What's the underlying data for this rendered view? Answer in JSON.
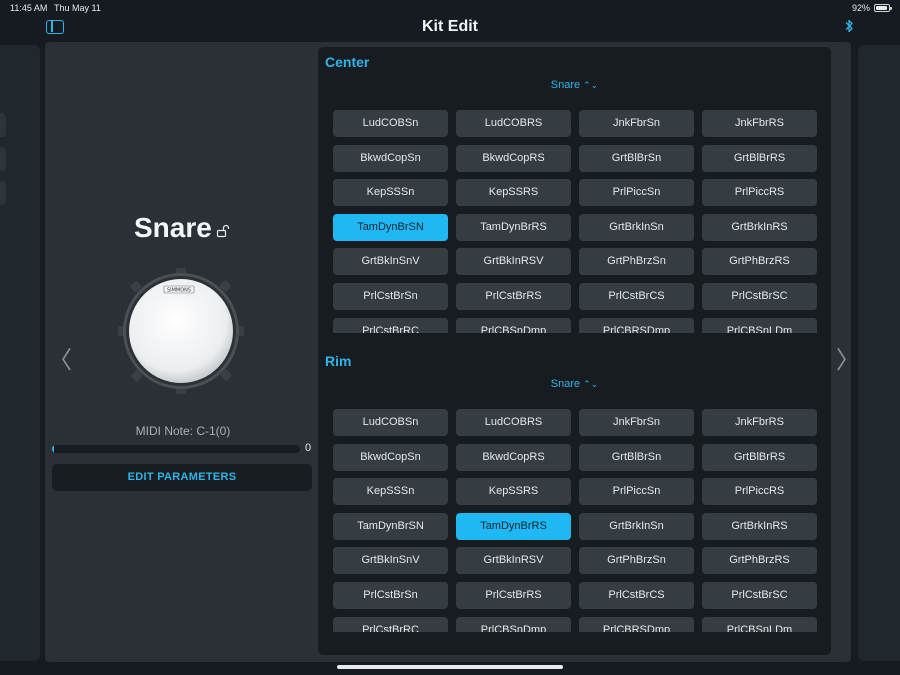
{
  "status": {
    "time": "11:45 AM",
    "date": "Thu May 11",
    "battery": "92%"
  },
  "nav": {
    "title": "Kit Edit"
  },
  "pad": {
    "name": "Snare",
    "midi_note": "MIDI Note: C-1(0)",
    "velocity_value": "0",
    "velocity_fraction": 0,
    "edit_button": "EDIT PARAMETERS",
    "drum_brand": "SIMMONS"
  },
  "chevrons": {
    "left": "〈",
    "right": "〉"
  },
  "sections": [
    {
      "title": "Center",
      "group": "Snare",
      "selected_index": 12,
      "items": [
        "LudCOBSn",
        "LudCOBRS",
        "JnkFbrSn",
        "JnkFbrRS",
        "BkwdCopSn",
        "BkwdCopRS",
        "GrtBlBrSn",
        "GrtBlBrRS",
        "KepSSSn",
        "KepSSRS",
        "PrlPiccSn",
        "PrlPiccRS",
        "TamDynBrSN",
        "TamDynBrRS",
        "GrtBrkInSn",
        "GrtBrkInRS",
        "GrtBkInSnV",
        "GrtBkInRSV",
        "GrtPhBrzSn",
        "GrtPhBrzRS",
        "PrlCstBrSn",
        "PrlCstBrRS",
        "PrlCstBrCS",
        "PrlCstBrSC",
        "PrlCstBrRC",
        "PrlCBSnDmp",
        "PrlCBRSDmp",
        "PrlCBSnLDm"
      ]
    },
    {
      "title": "Rim",
      "group": "Snare",
      "selected_index": 13,
      "items": [
        "LudCOBSn",
        "LudCOBRS",
        "JnkFbrSn",
        "JnkFbrRS",
        "BkwdCopSn",
        "BkwdCopRS",
        "GrtBlBrSn",
        "GrtBlBrRS",
        "KepSSSn",
        "KepSSRS",
        "PrlPiccSn",
        "PrlPiccRS",
        "TamDynBrSN",
        "TamDynBrRS",
        "GrtBrkInSn",
        "GrtBrkInRS",
        "GrtBkInSnV",
        "GrtBkInRSV",
        "GrtPhBrzSn",
        "GrtPhBrzRS",
        "PrlCstBrSn",
        "PrlCstBrRS",
        "PrlCstBrCS",
        "PrlCstBrSC",
        "PrlCstBrRC",
        "PrlCBSnDmp",
        "PrlCBRSDmp",
        "PrlCBSnLDm"
      ]
    }
  ],
  "colors": {
    "accent": "#2fb4ea",
    "selected": "#1fb8f2",
    "background": "#151b20"
  }
}
